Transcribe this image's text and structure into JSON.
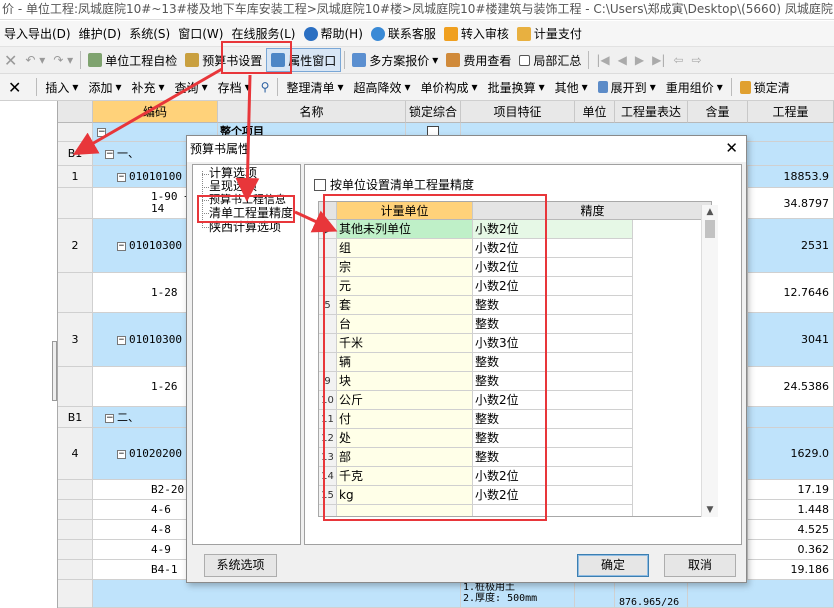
{
  "window": {
    "title": "价 - 单位工程:凤城庭院10#~13#楼及地下车库安装工程>凤城庭院10#楼>凤城庭院10#楼建筑与装饰工程 - C:\\Users\\郑成寅\\Desktop\\(5660) 凤城庭院10#"
  },
  "menu": [
    {
      "label": "导入导出(D)"
    },
    {
      "label": "维护(D)"
    },
    {
      "label": "系统(S)"
    },
    {
      "label": "窗口(W)"
    },
    {
      "label": "在线服务(L)"
    },
    {
      "label": "帮助(H)",
      "icon": "help-icon"
    },
    {
      "label": "联系客服",
      "icon": "customer-service-icon"
    },
    {
      "label": "转入审核",
      "icon": "audit-icon"
    },
    {
      "label": "计量支付",
      "icon": "payment-icon"
    }
  ],
  "toolbar1": {
    "unit_check": "单位工程自检",
    "budget_settings": "预算书设置",
    "property_window": "属性窗口",
    "multi_plan": "多方案报价",
    "fee_view": "费用查看",
    "partial_summary": "局部汇总"
  },
  "toolbar2": [
    "插入",
    "添加",
    "补充",
    "查询",
    "存档",
    "整理清单",
    "超高降效",
    "单价构成",
    "批量换算",
    "其他",
    "展开到",
    "重用组价",
    "锁定清"
  ],
  "grid": {
    "headers": {
      "code": "编码",
      "name": "名称",
      "lock": "锁定综合",
      "feature": "项目特征",
      "unit": "单位",
      "expr": "工程量表达",
      "content": "含量",
      "qty": "工程量"
    },
    "top_row": {
      "name": "整个项目"
    },
    "rows": [
      {
        "num": "B1",
        "code": "一、",
        "qty": "",
        "style": "blue"
      },
      {
        "num": "1",
        "code": "01010100",
        "qty": "18853.9",
        "style": "blue"
      },
      {
        "num": "",
        "code": "1-90 + * 14",
        "qty": "34.8797",
        "style": "white"
      },
      {
        "num": "2",
        "code": "01010300",
        "qty": "2531",
        "style": "blue"
      },
      {
        "num": "",
        "code": "1-28",
        "qty": "12.7646",
        "style": "white"
      },
      {
        "num": "3",
        "code": "01010300",
        "qty": "3041",
        "style": "blue"
      },
      {
        "num": "",
        "code": "1-26",
        "qty": "24.5386",
        "style": "white"
      },
      {
        "num": "B1",
        "code": "二、",
        "qty": "",
        "style": "blue"
      },
      {
        "num": "4",
        "code": "01020200",
        "qty": "1629.0",
        "style": "blue"
      },
      {
        "num": "",
        "code": "B2-20",
        "qty": "17.19",
        "style": "white"
      },
      {
        "num": "",
        "code": "4-6",
        "qty": "1.448",
        "style": "white"
      },
      {
        "num": "",
        "code": "4-8",
        "qty": "4.525",
        "style": "white"
      },
      {
        "num": "",
        "code": "4-9",
        "qty": "0.362",
        "style": "white"
      },
      {
        "num": "",
        "code": "B4-1",
        "qty": "19.186",
        "style": "white"
      }
    ],
    "bottom_feature": [
      "1.桩极用土",
      "2.厚度: 500mm"
    ],
    "bottom_expr": "876.965/26"
  },
  "dialog": {
    "title": "预算书属性",
    "tree": [
      "计算选项",
      "呈现选项",
      "预算书工程信息",
      "清单工程量精度",
      "陕西计算选项"
    ],
    "checkbox_label": "按单位设置清单工程量精度",
    "table_headers": {
      "unit": "计量单位",
      "precision": "精度"
    },
    "rows": [
      {
        "num": "",
        "unit": "其他未列单位",
        "precision": "小数2位"
      },
      {
        "num": "",
        "unit": "组",
        "precision": "小数2位"
      },
      {
        "num": "",
        "unit": "宗",
        "precision": "小数2位"
      },
      {
        "num": "",
        "unit": "元",
        "precision": "小数2位"
      },
      {
        "num": "5",
        "unit": "套",
        "precision": "整数"
      },
      {
        "num": "",
        "unit": "台",
        "precision": "整数"
      },
      {
        "num": "",
        "unit": "千米",
        "precision": "小数3位"
      },
      {
        "num": "",
        "unit": "辆",
        "precision": "整数"
      },
      {
        "num": "9",
        "unit": "块",
        "precision": "整数"
      },
      {
        "num": "10",
        "unit": "公斤",
        "precision": "小数2位"
      },
      {
        "num": "11",
        "unit": "付",
        "precision": "整数"
      },
      {
        "num": "12",
        "unit": "处",
        "precision": "整数"
      },
      {
        "num": "13",
        "unit": "部",
        "precision": "整数"
      },
      {
        "num": "14",
        "unit": "千克",
        "precision": "小数2位"
      },
      {
        "num": "15",
        "unit": "kg",
        "precision": "小数2位"
      }
    ],
    "buttons": {
      "system": "系统选项",
      "ok": "确定",
      "cancel": "取消"
    }
  },
  "colors": {
    "highlight_red": "#e8363a",
    "row_blue": "#bfe3fb",
    "header_orange": "#ffd27a"
  }
}
